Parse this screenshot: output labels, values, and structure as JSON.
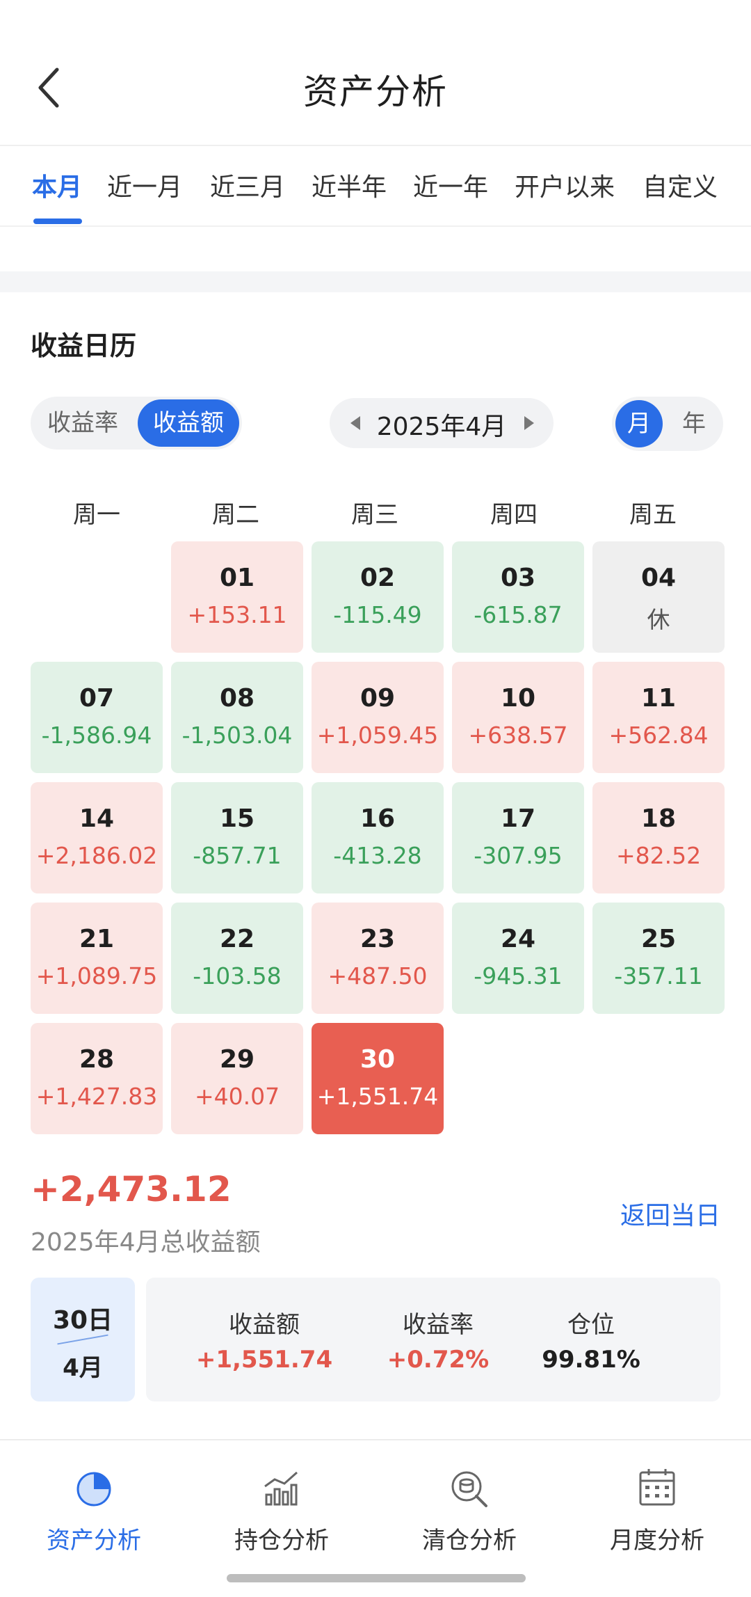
{
  "header": {
    "title": "资产分析"
  },
  "tabs": [
    {
      "label": "本月",
      "active": true
    },
    {
      "label": "近一月",
      "active": false
    },
    {
      "label": "近三月",
      "active": false
    },
    {
      "label": "近半年",
      "active": false
    },
    {
      "label": "近一年",
      "active": false
    },
    {
      "label": "开户以来",
      "active": false
    },
    {
      "label": "自定义",
      "active": false
    }
  ],
  "calendar": {
    "title": "收益日历",
    "mode_toggle": {
      "rate_label": "收益率",
      "amount_label": "收益额",
      "selected": "收益额"
    },
    "month_picker": {
      "value": "2025年4月"
    },
    "period_toggle": {
      "month_label": "月",
      "year_label": "年",
      "selected": "月"
    },
    "weekdays": [
      "周一",
      "周二",
      "周三",
      "周四",
      "周五"
    ],
    "days": [
      {
        "day": "01",
        "value": "+153.11",
        "state": "pos",
        "col": 1,
        "row": 0
      },
      {
        "day": "02",
        "value": "-115.49",
        "state": "neg",
        "col": 2,
        "row": 0
      },
      {
        "day": "03",
        "value": "-615.87",
        "state": "neg",
        "col": 3,
        "row": 0
      },
      {
        "day": "04",
        "value": "休",
        "state": "off",
        "col": 4,
        "row": 0
      },
      {
        "day": "07",
        "value": "-1,586.94",
        "state": "neg",
        "col": 0,
        "row": 1
      },
      {
        "day": "08",
        "value": "-1,503.04",
        "state": "neg",
        "col": 1,
        "row": 1
      },
      {
        "day": "09",
        "value": "+1,059.45",
        "state": "pos",
        "col": 2,
        "row": 1
      },
      {
        "day": "10",
        "value": "+638.57",
        "state": "pos",
        "col": 3,
        "row": 1
      },
      {
        "day": "11",
        "value": "+562.84",
        "state": "pos",
        "col": 4,
        "row": 1
      },
      {
        "day": "14",
        "value": "+2,186.02",
        "state": "pos",
        "col": 0,
        "row": 2
      },
      {
        "day": "15",
        "value": "-857.71",
        "state": "neg",
        "col": 1,
        "row": 2
      },
      {
        "day": "16",
        "value": "-413.28",
        "state": "neg",
        "col": 2,
        "row": 2
      },
      {
        "day": "17",
        "value": "-307.95",
        "state": "neg",
        "col": 3,
        "row": 2
      },
      {
        "day": "18",
        "value": "+82.52",
        "state": "pos",
        "col": 4,
        "row": 2
      },
      {
        "day": "21",
        "value": "+1,089.75",
        "state": "pos",
        "col": 0,
        "row": 3
      },
      {
        "day": "22",
        "value": "-103.58",
        "state": "neg",
        "col": 1,
        "row": 3
      },
      {
        "day": "23",
        "value": "+487.50",
        "state": "pos",
        "col": 2,
        "row": 3
      },
      {
        "day": "24",
        "value": "-945.31",
        "state": "neg",
        "col": 3,
        "row": 3
      },
      {
        "day": "25",
        "value": "-357.11",
        "state": "neg",
        "col": 4,
        "row": 3
      },
      {
        "day": "28",
        "value": "+1,427.83",
        "state": "pos",
        "col": 0,
        "row": 4
      },
      {
        "day": "29",
        "value": "+40.07",
        "state": "pos",
        "col": 1,
        "row": 4
      },
      {
        "day": "30",
        "value": "+1,551.74",
        "state": "sel",
        "col": 2,
        "row": 4
      }
    ]
  },
  "summary": {
    "total": "+2,473.12",
    "total_label": "2025年4月总收益额",
    "back_today": "返回当日"
  },
  "detail": {
    "day": "30日",
    "month": "4月",
    "stats": [
      {
        "label": "收益额",
        "value": "+1,551.74",
        "tone": "red"
      },
      {
        "label": "收益率",
        "value": "+0.72%",
        "tone": "red"
      },
      {
        "label": "仓位",
        "value": "99.81%",
        "tone": "dark"
      }
    ]
  },
  "bottom_nav": [
    {
      "label": "资产分析",
      "icon": "pie-chart-icon",
      "active": true
    },
    {
      "label": "持仓分析",
      "icon": "bar-trend-icon",
      "active": false
    },
    {
      "label": "清仓分析",
      "icon": "coin-search-icon",
      "active": false
    },
    {
      "label": "月度分析",
      "icon": "calendar-icon",
      "active": false
    }
  ],
  "colors": {
    "accent": "#2a6de6",
    "gain": "#e2574c",
    "loss": "#3aa05a",
    "gain_bg": "#fbe6e4",
    "loss_bg": "#e2f2e7"
  }
}
